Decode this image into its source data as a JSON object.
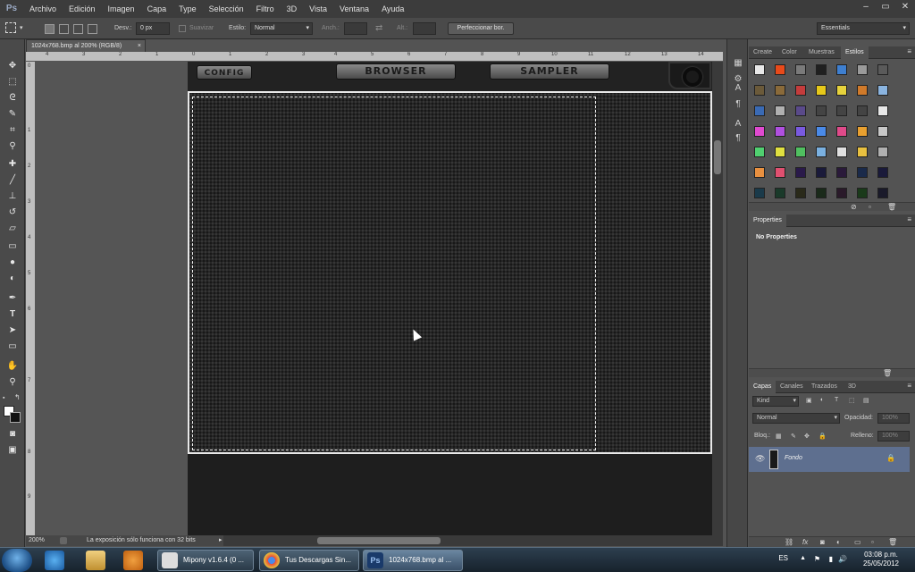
{
  "menubar": {
    "logo": "Ps",
    "items": [
      "Archivo",
      "Edición",
      "Imagen",
      "Capa",
      "Type",
      "Selección",
      "Filtro",
      "3D",
      "Vista",
      "Ventana",
      "Ayuda"
    ],
    "window_controls": [
      "–",
      "▭",
      "✕"
    ]
  },
  "options": {
    "feather_label": "Desv.:",
    "feather_value": "0 px",
    "smooth_label": "Suavizar",
    "style_label": "Estilo:",
    "style_value": "Normal",
    "width_label": "Anch.:",
    "height_label": "Alt.:",
    "refine_button": "Perfeccionar bor.",
    "workspace": "Essentials"
  },
  "document": {
    "tab_title": "1024x768.bmp al 200% (RGB/8)",
    "ruler_top": [
      "4",
      "3",
      "2",
      "1",
      "0",
      "1",
      "2",
      "3",
      "4",
      "5",
      "6",
      "7",
      "8",
      "9",
      "10",
      "11",
      "12",
      "13",
      "14"
    ],
    "ruler_left": [
      "0",
      "1",
      "2",
      "3",
      "4",
      "5",
      "6",
      "7",
      "8",
      "9"
    ],
    "app_buttons": [
      "CONFIG",
      "BROWSER",
      "SAMPLER"
    ],
    "zoom": "200%",
    "status_text": "La exposición sólo funciona con 32 bits"
  },
  "styles_panel": {
    "tabs": [
      "Create",
      "Color",
      "Muestras",
      "Estilos"
    ],
    "active_tab": "Estilos",
    "swatch_colors": [
      [
        "#e8e8e8",
        "#e84a1a",
        "#7a7a7a",
        "#202020",
        "#3e7fd0",
        "#9a9a9a",
        "#5a5a5a"
      ],
      [
        "#6b5a3a",
        "#8a6a3a",
        "#c43c3c",
        "#e6c81a",
        "#e6d23c",
        "#d07a2a",
        "#8ab4e0"
      ],
      [
        "#3a6ab4",
        "#b0b0b0",
        "#5a4a8a",
        "#444444",
        "#444444",
        "#444444",
        "#e8e8e8"
      ],
      [
        "#e04ad0",
        "#b050e0",
        "#7a5ae0",
        "#4a8ae8",
        "#e04a8a",
        "#e8a030",
        "#c8c8c8"
      ],
      [
        "#50d070",
        "#e0e040",
        "#50c060",
        "#7ab0e0",
        "#e0e0e0",
        "#e8c040",
        "#b0b0b0"
      ],
      [
        "#e89040",
        "#e05070",
        "#2a1a4a",
        "#1a1a3a",
        "#2a1a3a",
        "#1a2a4a",
        "#1a1a3a"
      ],
      [
        "#1a3a4a",
        "#1a3a2a",
        "#2a2a1a",
        "#1a2a1a",
        "#2a1a2a",
        "#1a3a1a",
        "#1a1a2a"
      ]
    ]
  },
  "properties_panel": {
    "title": "Properties",
    "message": "No Properties"
  },
  "layers_panel": {
    "tabs": [
      "Capas",
      "Canales",
      "Trazados",
      "3D"
    ],
    "active_tab": "Capas",
    "filter_kind": "Kind",
    "blend_mode": "Normal",
    "opacity_label": "Opacidad:",
    "opacity_value": "100%",
    "lock_label": "Bloq.:",
    "fill_label": "Relleno:",
    "fill_value": "100%",
    "layers": [
      {
        "name": "Fondo",
        "visible": true,
        "locked": true
      }
    ]
  },
  "taskbar": {
    "tasks": [
      "Mipony v1.6.4 (0 ...",
      "Tus Descargas Sin...",
      "1024x768.bmp al ..."
    ],
    "language": "ES",
    "time": "03:08 p.m.",
    "date": "25/05/2012"
  },
  "colors": {
    "accent": "#5e6f8f",
    "ui_dark": "#535353"
  }
}
